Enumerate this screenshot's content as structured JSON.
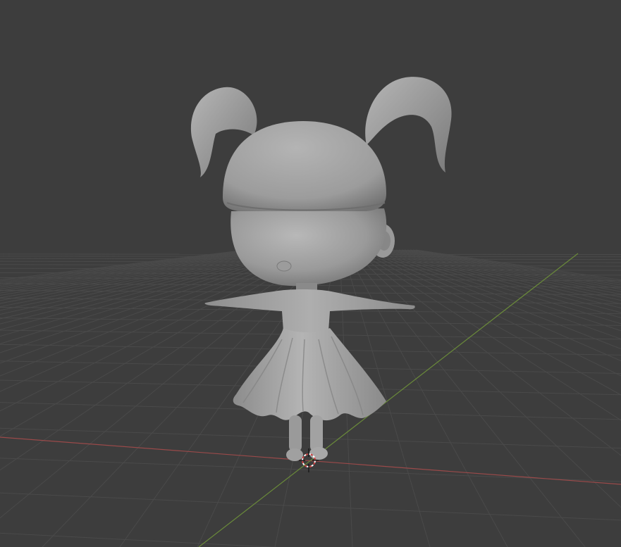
{
  "viewport": {
    "background": "#3d3d3d",
    "grid_color": "#4a4a4a",
    "x_axis_color": "#9a4a4a",
    "y_axis_color": "#6a8a3a",
    "model_color": "#a8a8a8",
    "cursor_colors": [
      "#ffffff",
      "#d04040"
    ],
    "model": "chibi-girl-character",
    "pose": "T-pose"
  }
}
